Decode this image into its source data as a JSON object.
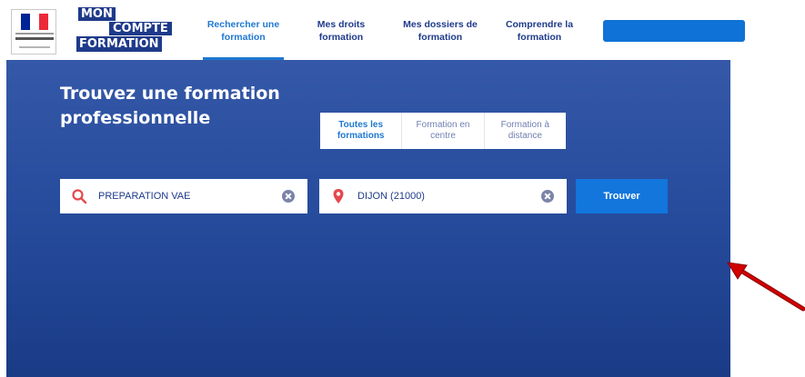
{
  "header": {
    "brand": {
      "line1": "MON",
      "line2": "COMPTE",
      "line3": "FORMATION"
    },
    "nav": [
      {
        "label": "Rechercher une\nformation",
        "active": true
      },
      {
        "label": "Mes droits\nformation",
        "active": false
      },
      {
        "label": "Mes dossiers de\nformation",
        "active": false
      },
      {
        "label": "Comprendre la\nformation",
        "active": false
      }
    ],
    "accent_color": "#1f78d1",
    "brand_color": "#1e3a8a"
  },
  "hero": {
    "title": "Trouvez une formation professionnelle",
    "tabs": [
      {
        "label": "Toutes les\nformations",
        "active": true
      },
      {
        "label": "Formation en\ncentre",
        "active": false
      },
      {
        "label": "Formation à\ndistance",
        "active": false
      }
    ],
    "search": {
      "what_value": "PREPARATION VAE",
      "what_icon": "search-icon",
      "where_value": "DIJON (21000)",
      "where_icon": "location-pin-icon",
      "clear_icon": "clear-icon"
    },
    "submit_label": "Trouver"
  },
  "annotation": {
    "icon": "red-arrow-icon",
    "color": "#d00000"
  }
}
